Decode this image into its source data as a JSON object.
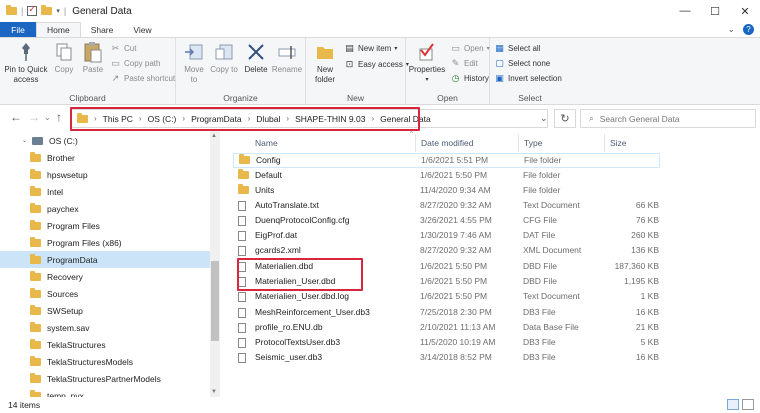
{
  "window": {
    "title": "General Data",
    "minimize": "—",
    "maximize": "☐",
    "close": "✕"
  },
  "ribbon_tabs": [
    "File",
    "Home",
    "Share",
    "View"
  ],
  "ribbon": {
    "clipboard": {
      "group": "Clipboard",
      "pin": "Pin to Quick access",
      "copy": "Copy",
      "paste": "Paste",
      "cut": "Cut",
      "copy_path": "Copy path",
      "paste_shortcut": "Paste shortcut"
    },
    "organize": {
      "group": "Organize",
      "move_to": "Move to",
      "copy_to": "Copy to",
      "delete": "Delete",
      "rename": "Rename"
    },
    "new": {
      "group": "New",
      "new_folder": "New folder",
      "new_item": "New item",
      "easy_access": "Easy access"
    },
    "open": {
      "group": "Open",
      "properties": "Properties",
      "open": "Open",
      "edit": "Edit",
      "history": "History"
    },
    "select": {
      "group": "Select",
      "select_all": "Select all",
      "select_none": "Select none",
      "invert_selection": "Invert selection"
    }
  },
  "address": {
    "crumbs": [
      "This PC",
      "OS (C:)",
      "ProgramData",
      "Dlubal",
      "SHAPE-THIN 9.03",
      "General Data"
    ],
    "search_placeholder": "Search General Data"
  },
  "nav_pane": [
    {
      "label": "OS (C:)",
      "type": "drive"
    },
    {
      "label": "Brother",
      "type": "folder"
    },
    {
      "label": "hpswsetup",
      "type": "folder"
    },
    {
      "label": "Intel",
      "type": "folder"
    },
    {
      "label": "paychex",
      "type": "folder"
    },
    {
      "label": "Program Files",
      "type": "folder"
    },
    {
      "label": "Program Files (x86)",
      "type": "folder"
    },
    {
      "label": "ProgramData",
      "type": "folder",
      "selected": true
    },
    {
      "label": "Recovery",
      "type": "folder"
    },
    {
      "label": "Sources",
      "type": "folder"
    },
    {
      "label": "SWSetup",
      "type": "folder"
    },
    {
      "label": "system.sav",
      "type": "folder"
    },
    {
      "label": "TeklaStructures",
      "type": "folder"
    },
    {
      "label": "TeklaStructuresModels",
      "type": "folder"
    },
    {
      "label": "TeklaStructuresPartnerModels",
      "type": "folder"
    },
    {
      "label": "temp_pyx",
      "type": "folder"
    }
  ],
  "columns": {
    "name": "Name",
    "date": "Date modified",
    "type": "Type",
    "size": "Size"
  },
  "files": [
    {
      "name": "Config",
      "date": "1/6/2021 5:51 PM",
      "type": "File folder",
      "size": "",
      "kind": "folder"
    },
    {
      "name": "Default",
      "date": "1/6/2021 5:50 PM",
      "type": "File folder",
      "size": "",
      "kind": "folder"
    },
    {
      "name": "Units",
      "date": "11/4/2020 9:34 AM",
      "type": "File folder",
      "size": "",
      "kind": "folder"
    },
    {
      "name": "AutoTranslate.txt",
      "date": "8/27/2020 9:32 AM",
      "type": "Text Document",
      "size": "66 KB",
      "kind": "file"
    },
    {
      "name": "DuenqProtocolConfig.cfg",
      "date": "3/26/2021 4:55 PM",
      "type": "CFG File",
      "size": "76 KB",
      "kind": "file"
    },
    {
      "name": "EigProf.dat",
      "date": "1/30/2019 7:46 AM",
      "type": "DAT File",
      "size": "260 KB",
      "kind": "file"
    },
    {
      "name": "gcards2.xml",
      "date": "8/27/2020 9:32 AM",
      "type": "XML Document",
      "size": "136 KB",
      "kind": "file"
    },
    {
      "name": "Materialien.dbd",
      "date": "1/6/2021 5:50 PM",
      "type": "DBD File",
      "size": "187,360 KB",
      "kind": "file"
    },
    {
      "name": "Materialien_User.dbd",
      "date": "1/6/2021 5:50 PM",
      "type": "DBD File",
      "size": "1,195 KB",
      "kind": "file"
    },
    {
      "name": "Materialien_User.dbd.log",
      "date": "1/6/2021 5:50 PM",
      "type": "Text Document",
      "size": "1 KB",
      "kind": "file"
    },
    {
      "name": "MeshReinforcement_User.db3",
      "date": "7/25/2018 2:30 PM",
      "type": "DB3 File",
      "size": "16 KB",
      "kind": "file"
    },
    {
      "name": "profile_ro.ENU.db",
      "date": "2/10/2021 11:13 AM",
      "type": "Data Base File",
      "size": "21 KB",
      "kind": "file"
    },
    {
      "name": "ProtocolTextsUser.db3",
      "date": "11/5/2020 10:19 AM",
      "type": "DB3 File",
      "size": "5 KB",
      "kind": "file"
    },
    {
      "name": "Seismic_user.db3",
      "date": "3/14/2018 8:52 PM",
      "type": "DB3 File",
      "size": "16 KB",
      "kind": "file"
    }
  ],
  "status": {
    "item_count": "14 items"
  },
  "colors": {
    "accent": "#1a66c2",
    "highlight": "#d7263d",
    "folder": "#e8b84a",
    "selection": "#cce4f7"
  }
}
